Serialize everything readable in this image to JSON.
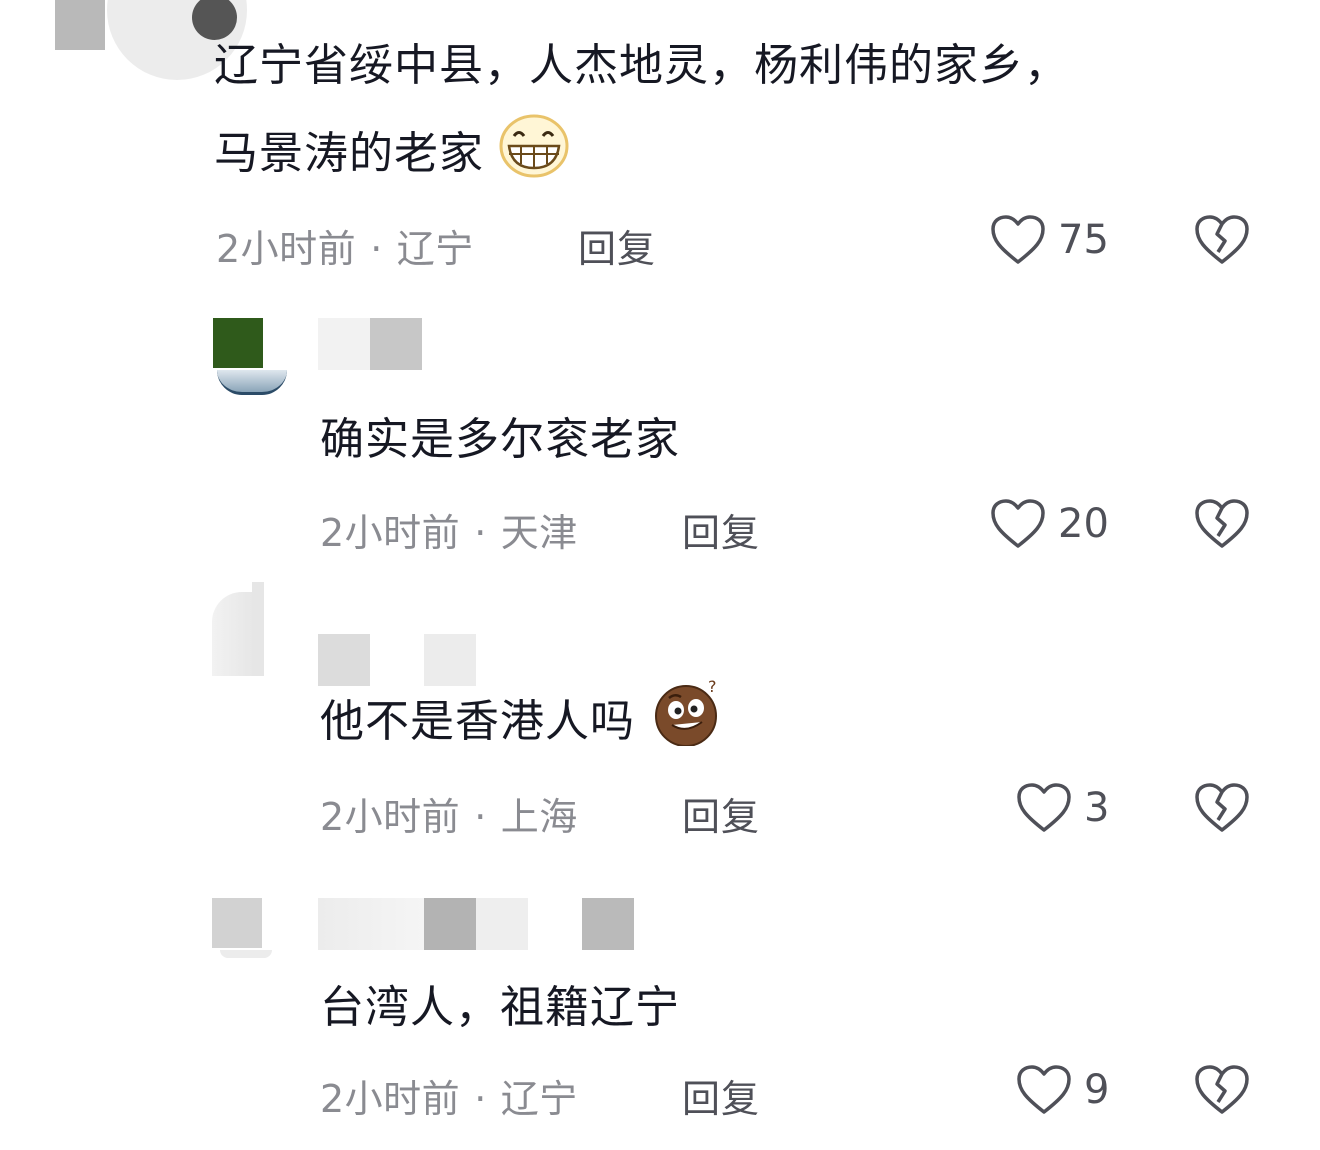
{
  "comments": [
    {
      "text_line1": "辽宁省绥中县，人杰地灵，杨利伟的家乡，",
      "text_line2": "马景涛的老家",
      "emoji": "grin-emoji",
      "time": "2小时前",
      "location": "辽宁",
      "reply_label": "回复",
      "likes": "75"
    },
    {
      "text": "确实是多尔衮老家",
      "time": "2小时前",
      "location": "天津",
      "reply_label": "回复",
      "likes": "20"
    },
    {
      "text": "他不是香港人吗",
      "emoji": "confused-emoji",
      "time": "2小时前",
      "location": "上海",
      "reply_label": "回复",
      "likes": "3"
    },
    {
      "text": "台湾人，祖籍辽宁",
      "time": "2小时前",
      "location": "辽宁",
      "reply_label": "回复",
      "likes": "9"
    }
  ],
  "separator": "·",
  "icons": {
    "like": "heart-outline-icon",
    "dislike": "broken-heart-icon"
  },
  "colors": {
    "text": "#161823",
    "meta": "#8a8b91",
    "icon": "#4f5058"
  }
}
